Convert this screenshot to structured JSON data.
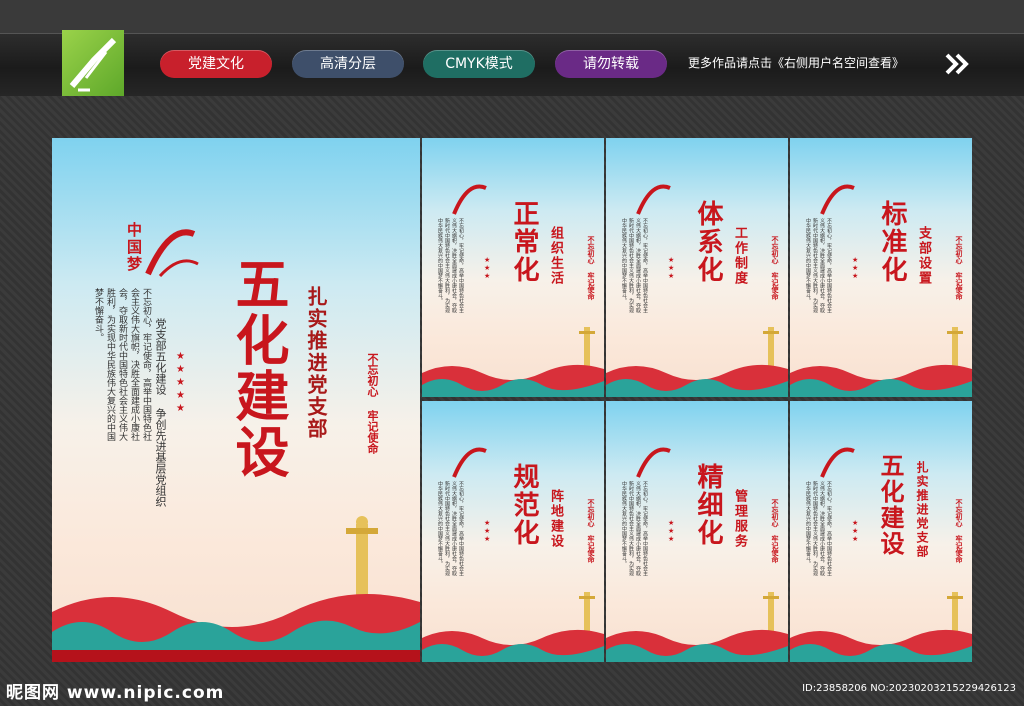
{
  "tags": [
    {
      "label": "党建文化",
      "color": "#c8202c"
    },
    {
      "label": "高清分层",
      "color": "#3e4f6a"
    },
    {
      "label": "CMYK模式",
      "color": "#1f6e63"
    },
    {
      "label": "请勿转载",
      "color": "#6a2a86"
    }
  ],
  "more_text": "更多作品请点击《右侧用户名空间查看》",
  "main_poster": {
    "logo_text": "中国梦",
    "title": "五化建设",
    "subtitle": "扎实推进党支部",
    "slogan": "不忘初心 牢记使命",
    "tagline": "党支部五化建设 争创先进基层党组织",
    "body": "不忘初心，牢记使命，高举中国特色社会主义伟大旗帜，决胜全面建成小康社会，夺取新时代中国特色社会主义伟大胜利，为实现中华民族伟大复兴的中国梦不懈奋斗。"
  },
  "small_posters": [
    {
      "title": "正常化",
      "subtitle": "组织生活"
    },
    {
      "title": "体系化",
      "subtitle": "工作制度"
    },
    {
      "title": "标准化",
      "subtitle": "支部设置"
    },
    {
      "title": "规范化",
      "subtitle": "阵地建设"
    },
    {
      "title": "精细化",
      "subtitle": "管理服务"
    },
    {
      "title": "五化建设",
      "subtitle": "扎实推进党支部"
    }
  ],
  "footer_left": "昵图网 www.nipic.com",
  "footer_right": "ID:23858206 NO:20230203215229426123"
}
